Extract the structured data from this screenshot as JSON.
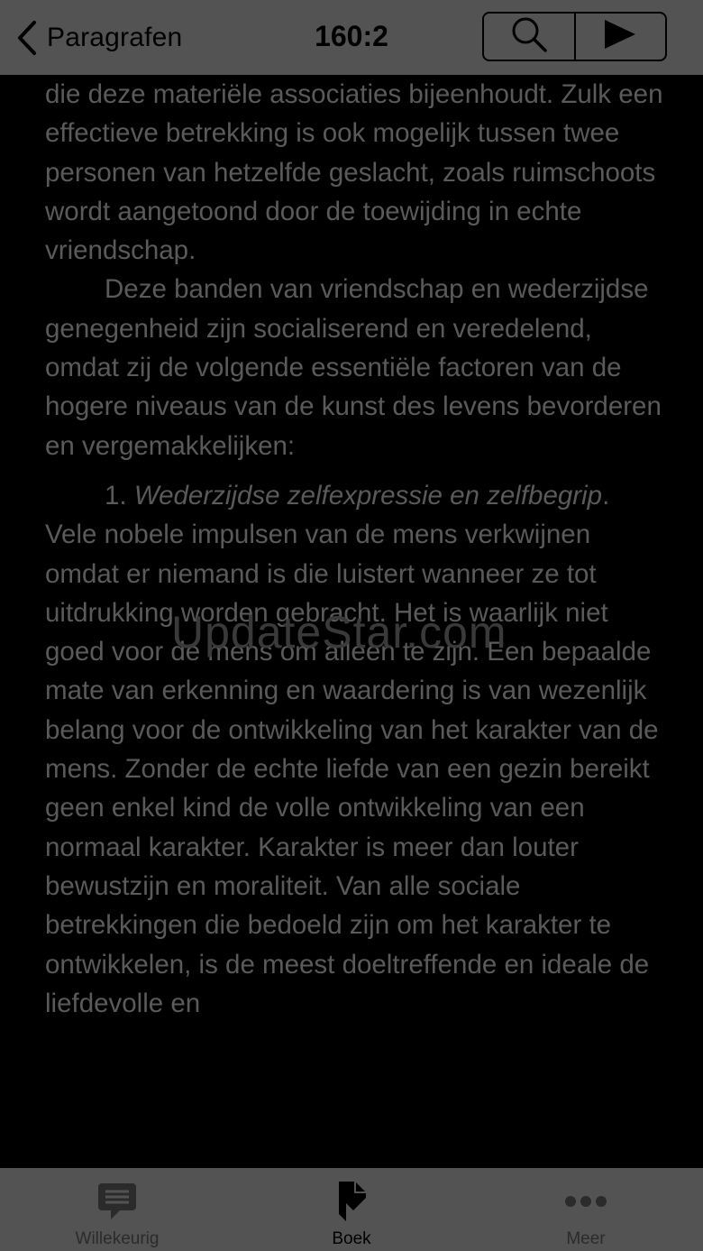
{
  "nav": {
    "back_label": "Paragrafen",
    "title": "160:2"
  },
  "content": {
    "paragraphs": [
      "die deze materiële associaties bijeenhoudt. Zulk een effectieve betrekking is ook mogelijk tussen twee personen van hetzelfde geslacht, zoals ruimschoots wordt aangetoond door de toewijding in echte vriendschap.",
      "Deze banden van vriendschap en wederzijdse genegenheid zijn socialiserend en veredelend, omdat zij de volgende essentiële factoren van de hogere niveaus van de kunst des levens bevorderen en vergemakkelijken:"
    ],
    "item_number": "1.",
    "item_title": "Wederzijdse zelfexpressie en zelfbegrip",
    "item_text": ". Vele nobele impulsen van de mens verkwijnen omdat er niemand is die luistert wanneer ze tot uitdrukking worden gebracht. Het is waarlijk niet goed voor de mens om alleen te zijn. Een bepaalde mate van erkenning en waardering is van wezenlijk belang voor de ontwikkeling van het karakter van de mens. Zonder de echte liefde van een gezin bereikt geen enkel kind de volle ontwikkeling van een normaal karakter. Karakter is meer dan louter bewustzijn en moraliteit. Van alle sociale betrekkingen die bedoeld zijn om het karakter te ontwikkelen, is de meest doeltreffende en ideale de liefdevolle en"
  },
  "watermark": "UpdateStar.com",
  "tabs": [
    {
      "label": "Willekeurig",
      "icon": "chat-bubble-icon"
    },
    {
      "label": "Boek",
      "icon": "bookmark-icon"
    },
    {
      "label": "Meer",
      "icon": "ellipsis-icon"
    }
  ],
  "colors": {
    "background": "#000000",
    "bar": "#535353",
    "text": "#5a5a5a"
  }
}
